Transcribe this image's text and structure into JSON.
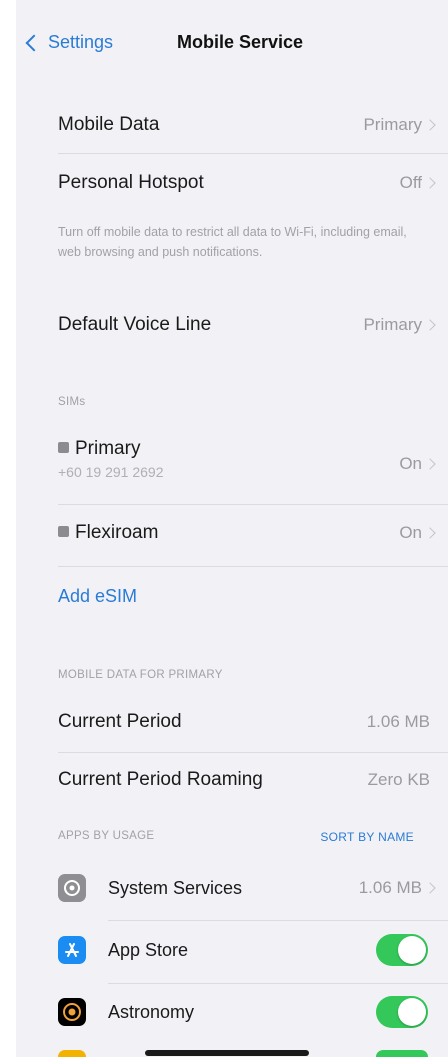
{
  "nav": {
    "back_label": "Settings",
    "title": "Mobile Service"
  },
  "top_rows": [
    {
      "label": "Mobile Data",
      "value": "Primary"
    },
    {
      "label": "Personal Hotspot",
      "value": "Off"
    }
  ],
  "hotspot_note": "Turn off mobile data to restrict all data to Wi-Fi, including email, web browsing and push notifications.",
  "voice_line": {
    "label": "Default Voice Line",
    "value": "Primary"
  },
  "sims_header": "SIMs",
  "sims": [
    {
      "label": "Primary",
      "number": "+60 19 291 2692",
      "status": "On"
    },
    {
      "label": "Flexiroam",
      "status": "On"
    }
  ],
  "add_esim": "Add eSIM",
  "mobile_data_header": "MOBILE DATA FOR PRIMARY",
  "usage_rows": [
    {
      "label": "Current Period",
      "value": "1.06 MB"
    },
    {
      "label": "Current Period Roaming",
      "value": "Zero KB"
    }
  ],
  "apps_header": "APPS BY USAGE",
  "sort_label": "SORT BY NAME",
  "apps": [
    {
      "name": "System Services",
      "value": "1.06 MB",
      "icon": "gear-icon"
    },
    {
      "name": "App Store",
      "enabled": true,
      "icon": "app-store-icon",
      "color": "#1a8cf2"
    },
    {
      "name": "Astronomy",
      "enabled": true,
      "icon": "astronomy-icon",
      "color": "#000000"
    }
  ],
  "colors": {
    "accent": "#2a7bd6",
    "toggle_on": "#34c759"
  }
}
